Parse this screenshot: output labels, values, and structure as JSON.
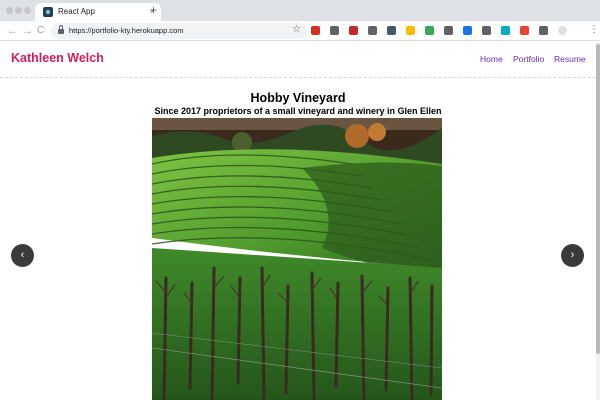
{
  "browser": {
    "tab_title": "React App",
    "tab_close": "×",
    "new_tab": "+",
    "back": "←",
    "forward": "→",
    "reload": "C",
    "url": "https://portfolio-kty.herokuapp.com",
    "bookmark_star": "☆",
    "menu": "⋮",
    "extension_colors": [
      "#d93025",
      "#5f6368",
      "#c62828",
      "#5f6368",
      "#455a64",
      "#fbbc04",
      "#34a853",
      "#5f6368",
      "#1a73e8",
      "#5f6368",
      "#00acc1",
      "#ea4335",
      "#5f6368",
      "#e0e0e0"
    ]
  },
  "site": {
    "brand": "Kathleen Welch",
    "nav": [
      "Home",
      "Portfolio",
      "Resume"
    ],
    "accent_color": "#d81b60",
    "nav_color": "#6a2cb0"
  },
  "carousel": {
    "title": "Hobby Vineyard",
    "subtitle": "Since 2017 proprietors of a small vineyard and winery in Glen Ellen",
    "image": "vineyard-photo",
    "prev": "‹",
    "next": "›"
  }
}
